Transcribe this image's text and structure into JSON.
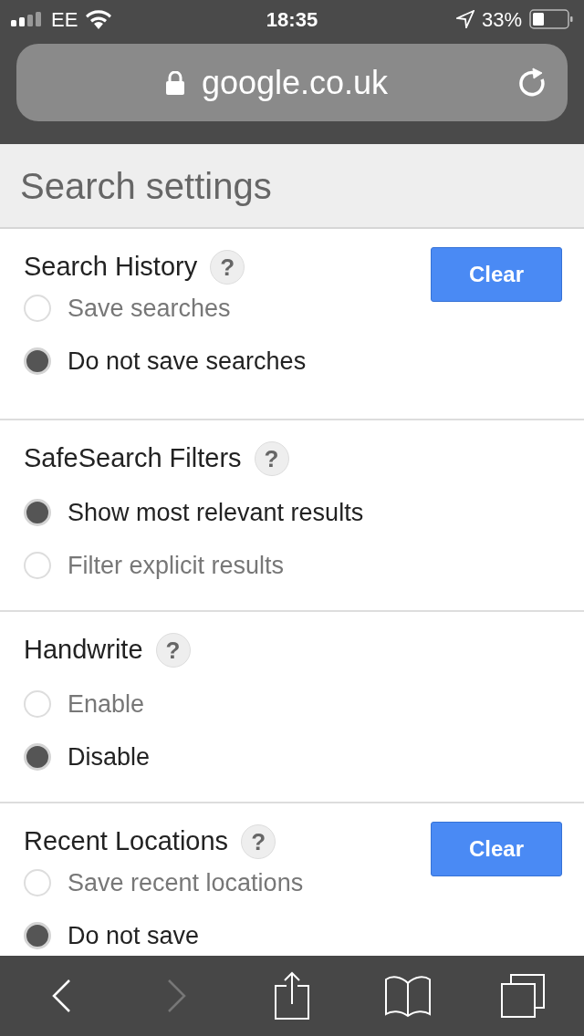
{
  "status_bar": {
    "carrier": "EE",
    "time": "18:35",
    "battery": "33%"
  },
  "address_bar": {
    "url": "google.co.uk"
  },
  "page_title": "Search settings",
  "sections": [
    {
      "title": "Search History",
      "help": "?",
      "button": "Clear",
      "options": [
        {
          "label": "Save searches",
          "selected": false
        },
        {
          "label": "Do not save searches",
          "selected": true
        }
      ]
    },
    {
      "title": "SafeSearch Filters",
      "help": "?",
      "options": [
        {
          "label": "Show most relevant results",
          "selected": true
        },
        {
          "label": "Filter explicit results",
          "selected": false
        }
      ]
    },
    {
      "title": "Handwrite",
      "help": "?",
      "options": [
        {
          "label": "Enable",
          "selected": false
        },
        {
          "label": "Disable",
          "selected": true
        }
      ]
    },
    {
      "title": "Recent Locations",
      "help": "?",
      "button": "Clear",
      "options": [
        {
          "label": "Save recent locations",
          "selected": false
        },
        {
          "label": "Do not save",
          "selected": true
        }
      ]
    }
  ],
  "toolbar": [
    {
      "kind": "back",
      "disabled": false
    },
    {
      "kind": "forward",
      "disabled": true
    },
    {
      "kind": "share",
      "disabled": false
    },
    {
      "kind": "bookmarks",
      "disabled": false
    },
    {
      "kind": "tabs",
      "disabled": false
    }
  ]
}
